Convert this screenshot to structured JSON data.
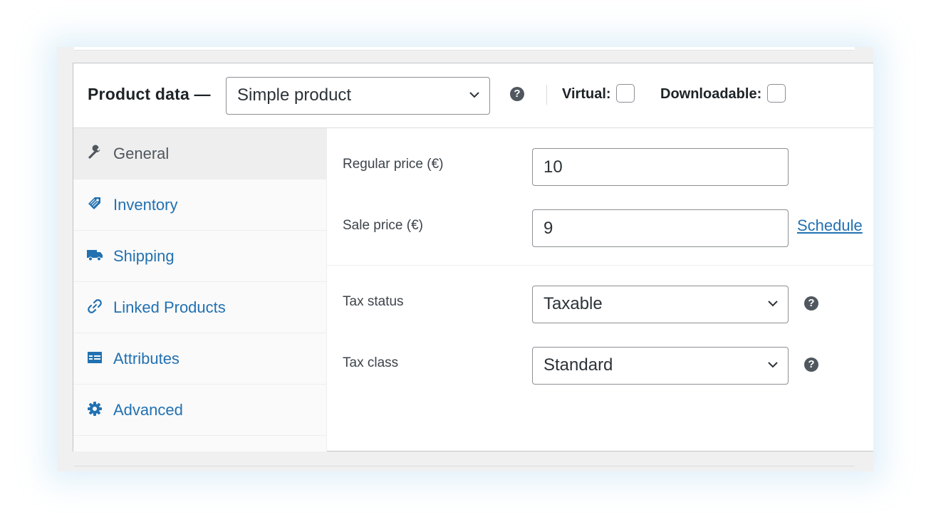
{
  "header": {
    "title": "Product data —",
    "product_type": "Simple product",
    "virtual_label": "Virtual:",
    "downloadable_label": "Downloadable:",
    "virtual_checked": false,
    "downloadable_checked": false
  },
  "tabs": [
    {
      "label": "General",
      "icon": "wrench-icon",
      "active": true
    },
    {
      "label": "Inventory",
      "icon": "tag-icon",
      "active": false
    },
    {
      "label": "Shipping",
      "icon": "truck-icon",
      "active": false
    },
    {
      "label": "Linked Products",
      "icon": "link-icon",
      "active": false
    },
    {
      "label": "Attributes",
      "icon": "list-icon",
      "active": false
    },
    {
      "label": "Advanced",
      "icon": "gear-icon",
      "active": false
    }
  ],
  "general": {
    "regular_price_label": "Regular price (€)",
    "regular_price_value": "10",
    "sale_price_label": "Sale price (€)",
    "sale_price_value": "9",
    "schedule_label": "Schedule",
    "tax_status_label": "Tax status",
    "tax_status_value": "Taxable",
    "tax_class_label": "Tax class",
    "tax_class_value": "Standard"
  },
  "help_glyph": "?",
  "colors": {
    "link": "#2271b1",
    "text": "#1d2327",
    "border": "#8c8f94",
    "active_tab_bg": "#eeeeee"
  }
}
